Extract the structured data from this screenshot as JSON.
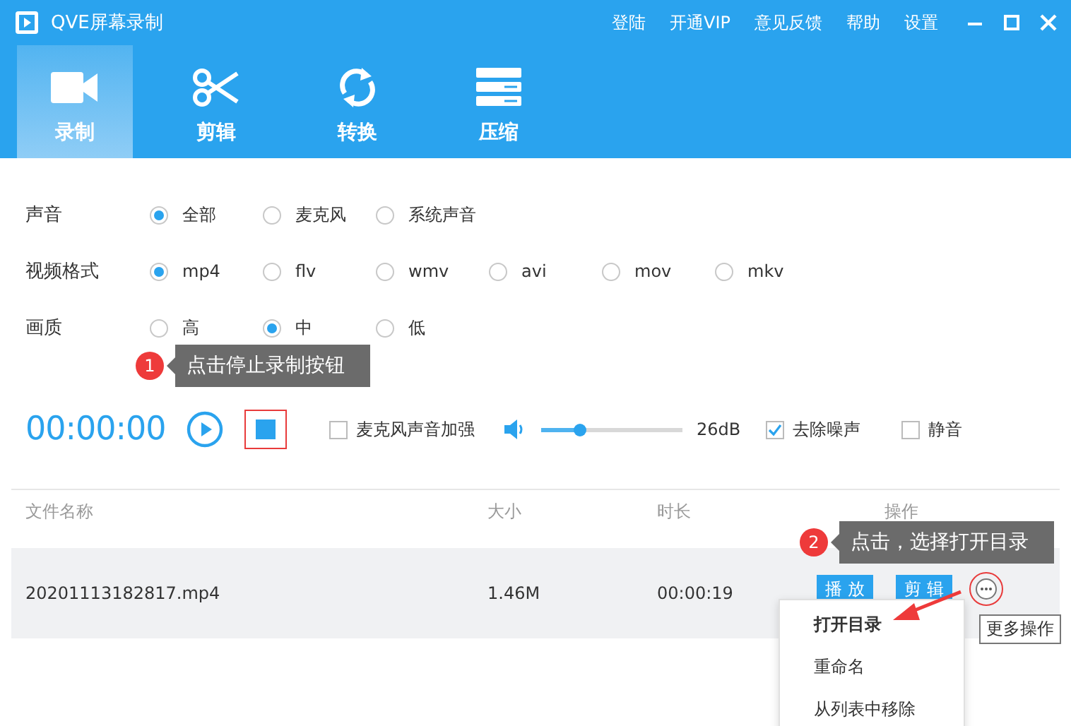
{
  "window": {
    "title": "QVE屏幕录制",
    "menu": [
      "登陆",
      "开通VIP",
      "意见反馈",
      "帮助",
      "设置"
    ]
  },
  "tabs": [
    {
      "label": "录制",
      "kind": "camera",
      "selected": true
    },
    {
      "label": "剪辑",
      "kind": "scissors",
      "selected": false
    },
    {
      "label": "转换",
      "kind": "convert",
      "selected": false
    },
    {
      "label": "压缩",
      "kind": "compress",
      "selected": false
    }
  ],
  "options": [
    {
      "label": "声音",
      "choices": [
        {
          "label": "全部",
          "selected": true
        },
        {
          "label": "麦克风",
          "selected": false
        },
        {
          "label": "系统声音",
          "selected": false
        }
      ]
    },
    {
      "label": "视频格式",
      "choices": [
        {
          "label": "mp4",
          "selected": true
        },
        {
          "label": "flv",
          "selected": false
        },
        {
          "label": "wmv",
          "selected": false
        },
        {
          "label": "avi",
          "selected": false
        },
        {
          "label": "mov",
          "selected": false
        },
        {
          "label": "mkv",
          "selected": false
        }
      ]
    },
    {
      "label": "画质",
      "choices": [
        {
          "label": "高",
          "selected": false
        },
        {
          "label": "中",
          "selected": true
        },
        {
          "label": "低",
          "selected": false
        }
      ]
    }
  ],
  "recorder": {
    "time": "00:00:00",
    "mic_boost": {
      "label": "麦克风声音加强",
      "checked": false
    },
    "volume": {
      "level": 0.27,
      "reading": "26dB"
    },
    "denoise": {
      "label": "去除噪声",
      "checked": true
    },
    "mute": {
      "label": "静音",
      "checked": false
    }
  },
  "table": {
    "columns": [
      "文件名称",
      "大小",
      "时长",
      "操作"
    ],
    "rows": [
      {
        "cells": [
          "20201113182817.mp4",
          "1.46M",
          "00:00:19"
        ],
        "actions": [
          "播放",
          "剪辑"
        ]
      }
    ]
  },
  "more_menu": {
    "items": [
      "打开目录",
      "重命名",
      "从列表中移除"
    ],
    "tooltip": "更多操作"
  },
  "callouts": [
    {
      "number": "1",
      "text": "点击停止录制按钮"
    },
    {
      "number": "2",
      "text": "点击，选择打开目录"
    }
  ]
}
